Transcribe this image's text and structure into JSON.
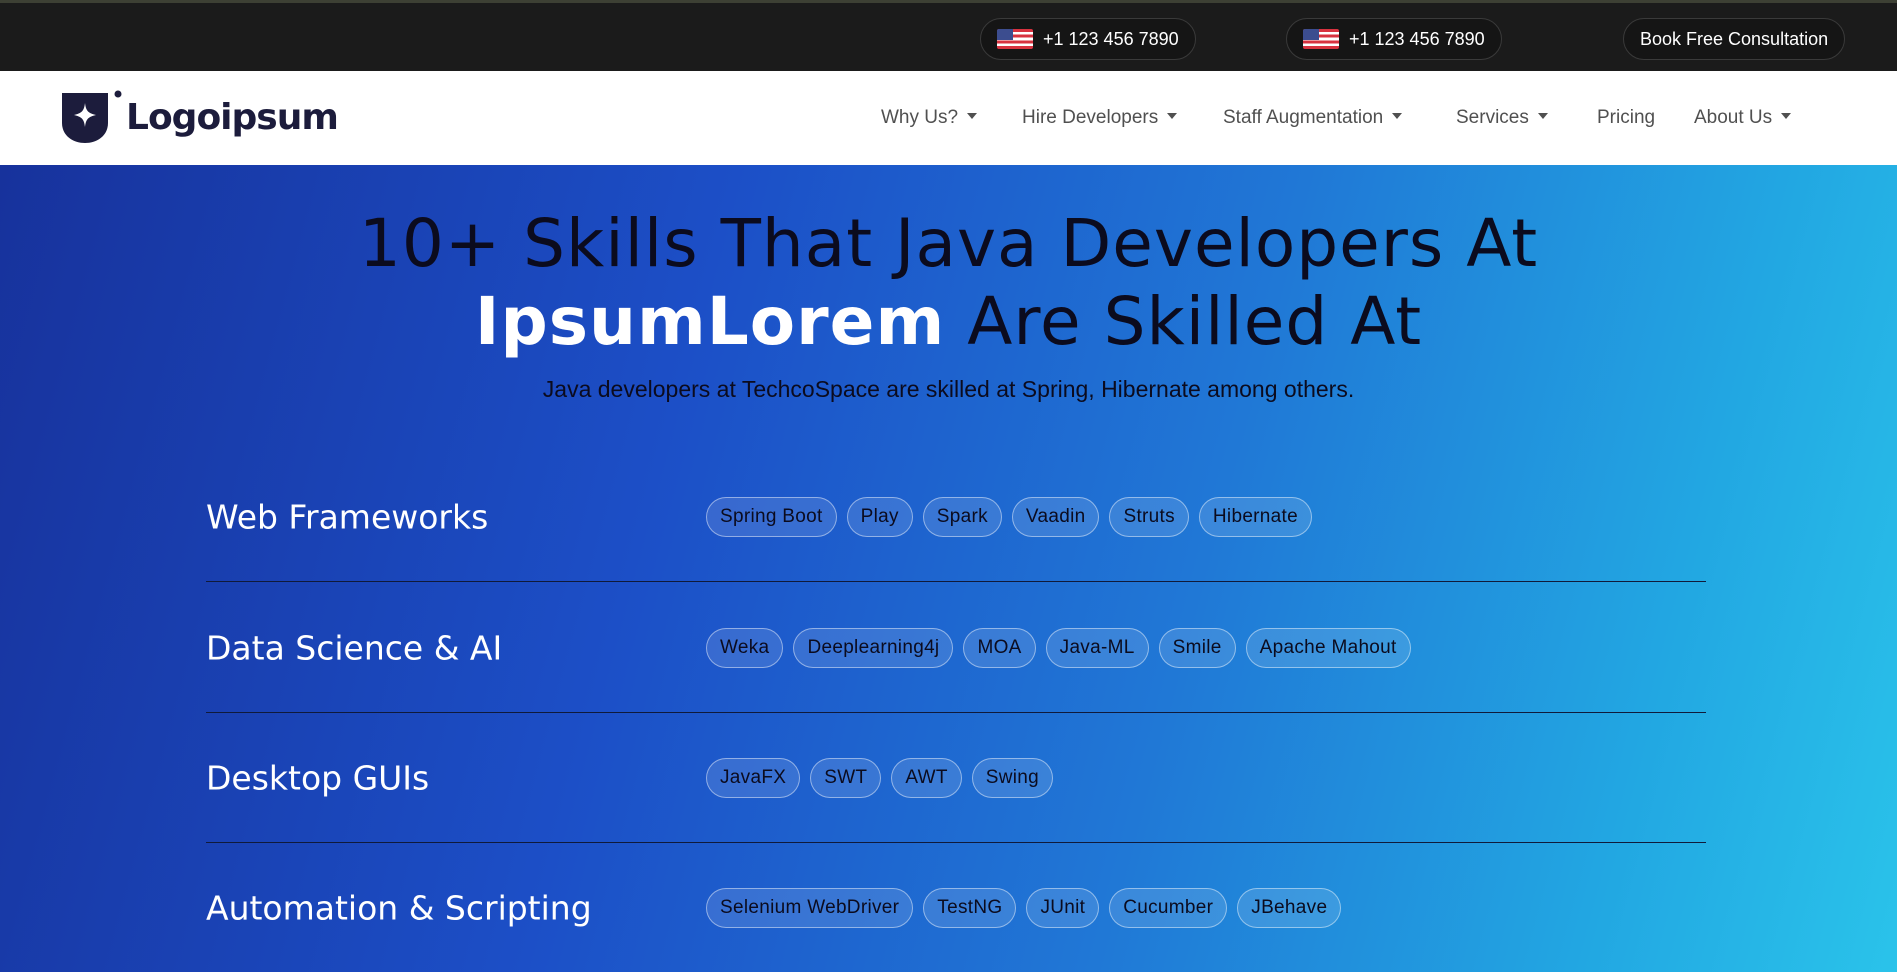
{
  "topbar": {
    "phone_1": "+1 123 456 7890",
    "phone_2": "+1 123 456 7890",
    "cta": "Book Free Consultation"
  },
  "header": {
    "logo_text": "Logoipsum",
    "nav": [
      {
        "label": "Why Us?",
        "dropdown": true
      },
      {
        "label": "Hire Developers",
        "dropdown": true
      },
      {
        "label": "Staff Augmentation",
        "dropdown": true
      },
      {
        "label": "Services",
        "dropdown": true
      },
      {
        "label": "Pricing",
        "dropdown": false
      },
      {
        "label": "About Us",
        "dropdown": true
      }
    ]
  },
  "hero": {
    "title_line1": "10+ Skills That Java Developers At",
    "title_highlight": "IpsumLorem",
    "title_line2_rest": " Are Skilled At",
    "subtitle": "Java developers at TechcoSpace are skilled at Spring, Hibernate among others."
  },
  "skills": [
    {
      "title": "Web Frameworks",
      "tags": [
        "Spring Boot",
        "Play",
        "Spark",
        "Vaadin",
        "Struts",
        "Hibernate"
      ]
    },
    {
      "title": "Data Science & AI",
      "tags": [
        "Weka",
        "Deeplearning4j",
        "MOA",
        "Java-ML",
        "Smile",
        "Apache Mahout"
      ]
    },
    {
      "title": "Desktop GUIs",
      "tags": [
        "JavaFX",
        "SWT",
        "AWT",
        "Swing"
      ]
    },
    {
      "title": "Automation & Scripting",
      "tags": [
        "Selenium WebDriver",
        "TestNG",
        "JUnit",
        "Cucumber",
        "JBehave"
      ]
    }
  ],
  "colors": {
    "topbar_bg": "#1b1b1b",
    "header_bg": "#ffffff",
    "hero_gradient_start": "#17329c",
    "hero_gradient_end": "#2ac3ea",
    "logo_color": "#1c1c3c"
  },
  "icons": {
    "flag": "us-flag-icon",
    "caret": "caret-down-icon",
    "logo": "logo-mark-icon"
  }
}
